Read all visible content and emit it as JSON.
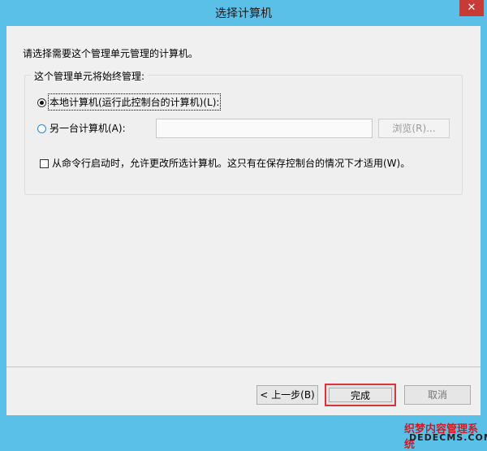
{
  "window": {
    "title": "选择计算机",
    "close_glyph": "✕"
  },
  "instruction": "请选择需要这个管理单元管理的计算机。",
  "group": {
    "label": "这个管理单元将始终管理:",
    "local_option": {
      "label": "本地计算机(运行此控制台的计算机)(L):",
      "selected": true
    },
    "other_option": {
      "label": "另一台计算机(A):",
      "selected": false
    },
    "computer_name_value": "",
    "browse_label": "浏览(R)..."
  },
  "checkbox": {
    "label": "从命令行启动时，允许更改所选计算机。这只有在保存控制台的情况下才适用(W)。",
    "checked": false
  },
  "buttons": {
    "back": "< 上一步(B)",
    "finish": "完成",
    "cancel": "取消"
  },
  "watermark": {
    "line1": "织梦内容管理系统",
    "line2": "DEDECMS.COM"
  },
  "colors": {
    "title_bar": "#5bc0e8",
    "close": "#c83a35",
    "highlight_border": "#d9343c"
  },
  "icons": [
    "close-icon"
  ]
}
